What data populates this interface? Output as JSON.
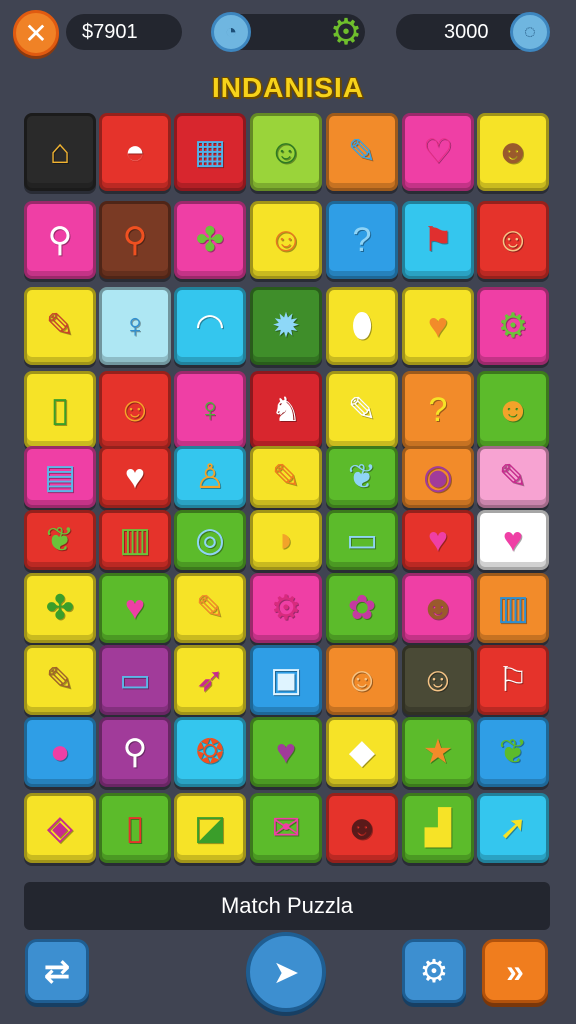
{
  "topbar": {
    "close_icon": "close-icon",
    "money": "$7901",
    "timer_icon": "timer-icon",
    "gear_icon": "gear-icon",
    "score": "3000",
    "score_icon": "score-icon"
  },
  "title": "INDANISIA",
  "colors": {
    "orange": "#f28b2a",
    "red": "#e5332b",
    "yellow": "#f6e327",
    "green": "#5cbb2b",
    "blue": "#2f9ee6",
    "pink": "#ef3fa5",
    "cyan": "#34c6ee",
    "brown": "#7a3a24",
    "darkgreen": "#3f8e2a",
    "darkolive": "#4a4a36",
    "black": "#222222",
    "purple": "#a13b9a",
    "lightpink": "#f7a3d2",
    "lightcyan": "#aee7f3",
    "white": "#ffffff"
  },
  "grid": {
    "columns": 7,
    "rows": [
      [
        {
          "name": "house-icon",
          "bg": "#2a2a2a",
          "glyph": "⌂",
          "fg": "#f2b431"
        },
        {
          "name": "bowl-icon",
          "bg": "#e5332b",
          "glyph": "◓",
          "fg": "#ffffff"
        },
        {
          "name": "toolbox-icon",
          "bg": "#d8262e",
          "glyph": "▦",
          "fg": "#4fb3e9"
        },
        {
          "name": "smiley-icon",
          "bg": "#9ad43a",
          "glyph": "☺",
          "fg": "#2e7a22"
        },
        {
          "name": "brush-icon",
          "bg": "#f28b2a",
          "glyph": "✎",
          "fg": "#3fa3e0"
        },
        {
          "name": "heart-icon",
          "bg": "#ef3fa5",
          "glyph": "♡",
          "fg": "#e82d86"
        },
        {
          "name": "face-icon",
          "bg": "#f6e327",
          "glyph": "☻",
          "fg": "#9a5a2c"
        }
      ],
      [
        {
          "name": "lollipop-icon",
          "bg": "#ef3fa5",
          "glyph": "⚲",
          "fg": "#ffffff"
        },
        {
          "name": "magnifier-icon",
          "bg": "#7a3a24",
          "glyph": "⚲",
          "fg": "#f05020"
        },
        {
          "name": "splat-icon",
          "bg": "#ef3fa5",
          "glyph": "✤",
          "fg": "#6cc23a"
        },
        {
          "name": "lion-icon",
          "bg": "#f6e327",
          "glyph": "☺",
          "fg": "#e7781f"
        },
        {
          "name": "question-icon",
          "bg": "#2f9ee6",
          "glyph": "?",
          "fg": "#8fd4f6"
        },
        {
          "name": "flag-icon",
          "bg": "#34c6ee",
          "glyph": "⚑",
          "fg": "#e02f2f"
        },
        {
          "name": "baby-face-icon",
          "bg": "#e5332b",
          "glyph": "☺",
          "fg": "#f6c486"
        }
      ],
      [
        {
          "name": "eraser-icon",
          "bg": "#f6e327",
          "glyph": "✎",
          "fg": "#c8452a"
        },
        {
          "name": "key-icon",
          "bg": "#aee7f3",
          "glyph": "♀",
          "fg": "#2f8fd0"
        },
        {
          "name": "pouch-icon",
          "bg": "#34c6ee",
          "glyph": "◠",
          "fg": "#ffffff"
        },
        {
          "name": "sun-icon",
          "bg": "#3f8e2a",
          "glyph": "✹",
          "fg": "#8ed8f8"
        },
        {
          "name": "pill-icon",
          "bg": "#f6e327",
          "glyph": "⬮",
          "fg": "#ffffff"
        },
        {
          "name": "heart-icon",
          "bg": "#f6e327",
          "glyph": "♥",
          "fg": "#f28b2a"
        },
        {
          "name": "cog-icon",
          "bg": "#ef3fa5",
          "glyph": "⚙",
          "fg": "#6cc23a"
        }
      ],
      [
        {
          "name": "phone-icon",
          "bg": "#f6e327",
          "glyph": "▯",
          "fg": "#3a9e2a"
        },
        {
          "name": "cat-face-icon",
          "bg": "#e5332b",
          "glyph": "☺",
          "fg": "#f6a32a"
        },
        {
          "name": "key-icon",
          "bg": "#ef3fa5",
          "glyph": "♀",
          "fg": "#4fb33a"
        },
        {
          "name": "rocking-horse-icon",
          "bg": "#d8262e",
          "glyph": "♞",
          "fg": "#ffffff"
        },
        {
          "name": "rolling-pin-icon",
          "bg": "#f6e327",
          "glyph": "✎",
          "fg": "#ffffff"
        },
        {
          "name": "question-icon",
          "bg": "#f28b2a",
          "glyph": "?",
          "fg": "#f6e327"
        },
        {
          "name": "tiki-icon",
          "bg": "#5cbb2b",
          "glyph": "☻",
          "fg": "#f2a32a"
        }
      ],
      [
        {
          "name": "books-icon",
          "bg": "#ef3fa5",
          "glyph": "▤",
          "fg": "#5bb7e8"
        },
        {
          "name": "heart-icon",
          "bg": "#e5332b",
          "glyph": "♥",
          "fg": "#ffffff"
        },
        {
          "name": "figure-icon",
          "bg": "#34c6ee",
          "glyph": "♙",
          "fg": "#f2a32a"
        },
        {
          "name": "carrot-icon",
          "bg": "#f6e327",
          "glyph": "✎",
          "fg": "#f07d1e"
        },
        {
          "name": "leaf-icon",
          "bg": "#5cbb2b",
          "glyph": "❦",
          "fg": "#8fd4f6"
        },
        {
          "name": "eye-icon",
          "bg": "#f28b2a",
          "glyph": "◉",
          "fg": "#a13b9a"
        },
        {
          "name": "eraser-icon",
          "bg": "#f7a3d2",
          "glyph": "✎",
          "fg": "#c92a8e"
        }
      ],
      [
        {
          "name": "leaf-icon",
          "bg": "#e5332b",
          "glyph": "❦",
          "fg": "#6cc23a"
        },
        {
          "name": "stripes-icon",
          "bg": "#e5332b",
          "glyph": "▥",
          "fg": "#6cc23a"
        },
        {
          "name": "ring-icon",
          "bg": "#5cbb2b",
          "glyph": "◎",
          "fg": "#8fd4f6"
        },
        {
          "name": "bread-icon",
          "bg": "#f6e327",
          "glyph": "◗",
          "fg": "#f2a32a"
        },
        {
          "name": "book-icon",
          "bg": "#5cbb2b",
          "glyph": "▭",
          "fg": "#8fd4f6"
        },
        {
          "name": "smiley-heart-icon",
          "bg": "#e5332b",
          "glyph": "♥",
          "fg": "#ef3fa5"
        },
        {
          "name": "heart-icon",
          "bg": "#ffffff",
          "glyph": "♥",
          "fg": "#ef3fa5"
        }
      ],
      [
        {
          "name": "turtle-icon",
          "bg": "#f6e327",
          "glyph": "✤",
          "fg": "#3a9e2a"
        },
        {
          "name": "heart-icon",
          "bg": "#5cbb2b",
          "glyph": "♥",
          "fg": "#ef3fa5"
        },
        {
          "name": "carrot-icon",
          "bg": "#f6e327",
          "glyph": "✎",
          "fg": "#f28b2a"
        },
        {
          "name": "cog-icon",
          "bg": "#ef3fa5",
          "glyph": "⚙",
          "fg": "#d82b7e"
        },
        {
          "name": "flower-icon",
          "bg": "#5cbb2b",
          "glyph": "✿",
          "fg": "#c43aa0"
        },
        {
          "name": "face-icon",
          "bg": "#ef3fa5",
          "glyph": "☻",
          "fg": "#9a5a2c"
        },
        {
          "name": "trash-icon",
          "bg": "#f28b2a",
          "glyph": "▥",
          "fg": "#2f8fd0"
        }
      ],
      [
        {
          "name": "shovel-icon",
          "bg": "#f6e327",
          "glyph": "✎",
          "fg": "#a0632a"
        },
        {
          "name": "sign-icon",
          "bg": "#a13b9a",
          "glyph": "▭",
          "fg": "#5bb7e8"
        },
        {
          "name": "rocket-icon",
          "bg": "#f6e327",
          "glyph": "➶",
          "fg": "#c92a8e"
        },
        {
          "name": "frame-icon",
          "bg": "#2f9ee6",
          "glyph": "▣",
          "fg": "#dff4ff"
        },
        {
          "name": "face-icon",
          "bg": "#f28b2a",
          "glyph": "☺",
          "fg": "#f6c486"
        },
        {
          "name": "face-icon",
          "bg": "#4a4a36",
          "glyph": "☺",
          "fg": "#f6c486"
        },
        {
          "name": "flag-icon",
          "bg": "#e5332b",
          "glyph": "⚐",
          "fg": "#ffffff"
        }
      ],
      [
        {
          "name": "bird-icon",
          "bg": "#2f9ee6",
          "glyph": "●",
          "fg": "#ef3fa5"
        },
        {
          "name": "magnifier-icon",
          "bg": "#a13b9a",
          "glyph": "⚲",
          "fg": "#ffffff"
        },
        {
          "name": "flame-icon",
          "bg": "#34c6ee",
          "glyph": "❂",
          "fg": "#f05020"
        },
        {
          "name": "speech-heart-icon",
          "bg": "#5cbb2b",
          "glyph": "♥",
          "fg": "#a13b9a"
        },
        {
          "name": "diamond-icon",
          "bg": "#f6e327",
          "glyph": "◆",
          "fg": "#ffffff"
        },
        {
          "name": "star-icon",
          "bg": "#5cbb2b",
          "glyph": "★",
          "fg": "#f28b2a"
        },
        {
          "name": "leaf-icon",
          "bg": "#2f9ee6",
          "glyph": "❦",
          "fg": "#5cbb2b"
        }
      ],
      [
        {
          "name": "bucket-icon",
          "bg": "#f6e327",
          "glyph": "◈",
          "fg": "#c92a8e"
        },
        {
          "name": "remote-icon",
          "bg": "#5cbb2b",
          "glyph": "▯",
          "fg": "#e5332b"
        },
        {
          "name": "cube-icon",
          "bg": "#f6e327",
          "glyph": "◪",
          "fg": "#3a9e2a"
        },
        {
          "name": "envelope-icon",
          "bg": "#5cbb2b",
          "glyph": "✉",
          "fg": "#ef3fa5"
        },
        {
          "name": "ninja-face-icon",
          "bg": "#e5332b",
          "glyph": "☻",
          "fg": "#5a1a1a"
        },
        {
          "name": "bar-chart-icon",
          "bg": "#5cbb2b",
          "glyph": "▟",
          "fg": "#f6e327"
        },
        {
          "name": "arrow-icon",
          "bg": "#34c6ee",
          "glyph": "➚",
          "fg": "#f6e327"
        }
      ]
    ]
  },
  "footer": {
    "label": "Match Puzzla",
    "shuffle_icon": "shuffle-icon",
    "pointer_icon": "pointer-icon",
    "settings_icon": "gear-icon",
    "skip_icon": "fast-forward-icon"
  }
}
